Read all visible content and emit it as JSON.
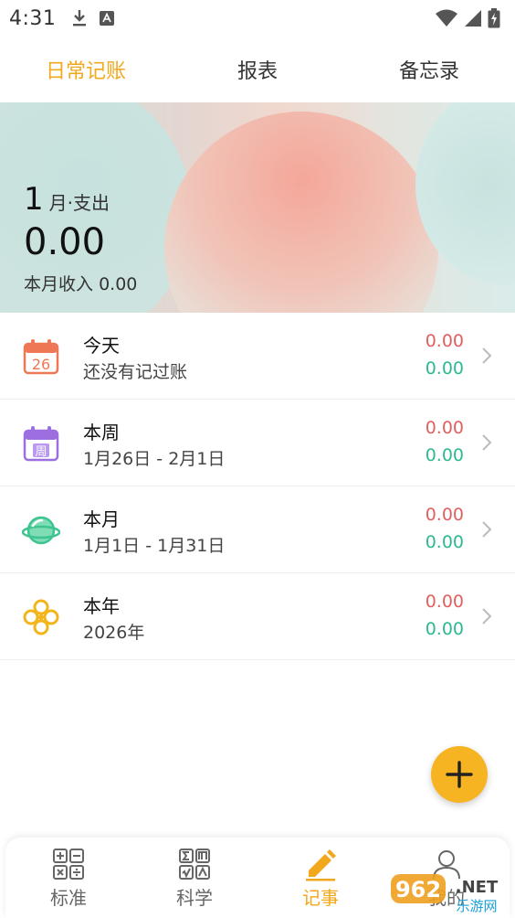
{
  "status_bar": {
    "time": "4:31"
  },
  "top_tabs": [
    {
      "label": "日常记账",
      "active": true
    },
    {
      "label": "报表",
      "active": false
    },
    {
      "label": "备忘录",
      "active": false
    }
  ],
  "banner": {
    "month_number": "1",
    "month_label": "月·支出",
    "expense_amount": "0.00",
    "income_label": "本月收入",
    "income_amount": "0.00"
  },
  "summary_rows": [
    {
      "title": "今天",
      "subtitle": "还没有记过账",
      "expense": "0.00",
      "income": "0.00",
      "icon": "calendar-day-icon",
      "icon_text": "26",
      "icon_color": "#ee7755"
    },
    {
      "title": "本周",
      "subtitle": "1月26日 - 2月1日",
      "expense": "0.00",
      "income": "0.00",
      "icon": "calendar-week-icon",
      "icon_text": "周",
      "icon_color": "#9b6fe0"
    },
    {
      "title": "本月",
      "subtitle": "1月1日 - 1月31日",
      "expense": "0.00",
      "income": "0.00",
      "icon": "planet-icon",
      "icon_color": "#3ec48f"
    },
    {
      "title": "本年",
      "subtitle": "2026年",
      "expense": "0.00",
      "income": "0.00",
      "icon": "knot-icon",
      "icon_color": "#f3b51c"
    }
  ],
  "colors": {
    "accent": "#f2a81d",
    "expense": "#e06060",
    "income": "#2eb894",
    "fab": "#f6b322"
  },
  "bottom_nav": [
    {
      "label": "标准",
      "icon": "standard-calculator-icon",
      "active": false
    },
    {
      "label": "科学",
      "icon": "scientific-calculator-icon",
      "active": false
    },
    {
      "label": "记事",
      "icon": "pencil-icon",
      "active": true
    },
    {
      "label": "我的",
      "icon": "profile-icon",
      "active": false
    }
  ],
  "watermark": {
    "brand": "962",
    "suffix": ".NET",
    "subtitle": "乐游网"
  }
}
